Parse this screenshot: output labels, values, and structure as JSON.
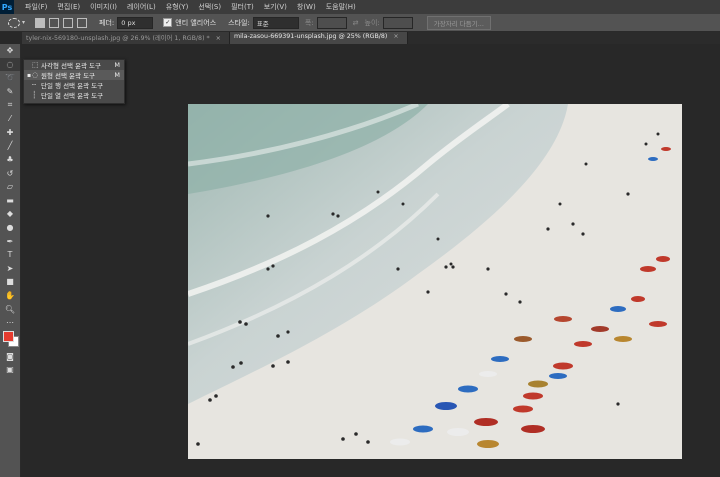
{
  "app": {
    "logo": "Ps"
  },
  "menu": [
    "파일(F)",
    "편집(E)",
    "이미지(I)",
    "레이어(L)",
    "유형(Y)",
    "선택(S)",
    "필터(T)",
    "보기(V)",
    "창(W)",
    "도움말(H)"
  ],
  "options": {
    "feather_label": "페더:",
    "feather_value": "0 px",
    "antialias_label": "앤티 앨리어스",
    "style_label": "스타일:",
    "style_value": "표준",
    "width_label": "폭:",
    "height_label": "높이:",
    "refine_button": "가장자리 다듬기..."
  },
  "tabs": [
    {
      "label": "tyler-nix-569180-unsplash.jpg @ 26.9% (레이어 1, RGB/8) *",
      "active": false
    },
    {
      "label": "mila-zasou-669391-unsplash.jpg @ 25% (RGB/8)",
      "active": true
    }
  ],
  "flyout": [
    {
      "label": "사각형 선택 윤곽 도구",
      "key": "M",
      "icon": "rect-marquee-icon",
      "active": false
    },
    {
      "label": "원형 선택 윤곽 도구",
      "key": "M",
      "icon": "ellipse-marquee-icon",
      "active": true
    },
    {
      "label": "단일 행 선택 윤곽 도구",
      "key": "",
      "icon": "single-row-marquee-icon",
      "active": false
    },
    {
      "label": "단일 열 선택 윤곽 도구",
      "key": "",
      "icon": "single-column-marquee-icon",
      "active": false
    }
  ],
  "colors": {
    "foreground": "#e63b2e",
    "background": "#ffffff",
    "accent": "#31a8ff"
  }
}
